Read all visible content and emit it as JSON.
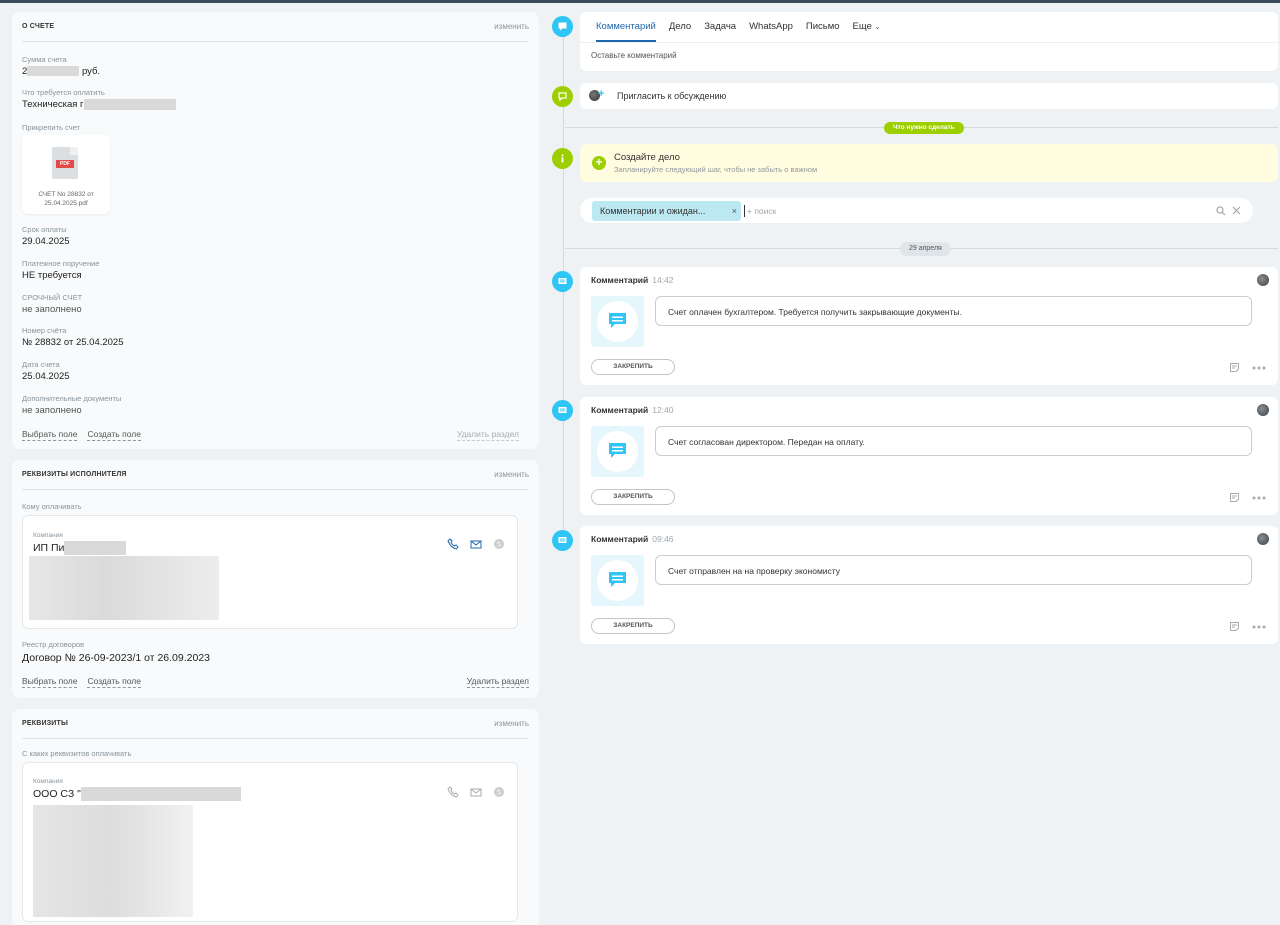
{
  "left": {
    "about": {
      "title": "О СЧЕТЕ",
      "edit": "изменить",
      "fields": [
        {
          "label": "Сумма счета",
          "value": "2",
          "suffix": "руб."
        },
        {
          "label": "Что требуется оплатить",
          "value": "Техническая г"
        },
        {
          "label": "Прикрепить счет"
        },
        {
          "label": "Срок оплаты",
          "value": "29.04.2025"
        },
        {
          "label": "Платежное поручение",
          "value": "НЕ требуется"
        },
        {
          "label": "СРОЧНЫЙ СЧЕТ",
          "value": "не заполнено"
        },
        {
          "label": "Номер счёта",
          "value": "№ 28832 от 25.04.2025"
        },
        {
          "label": "Дата счета",
          "value": "25.04.2025"
        },
        {
          "label": "Дополнительные документы",
          "value": "не заполнено"
        }
      ],
      "file_name": "СЧЕТ No 28832 от 25.04.2025.pdf",
      "file_badge": "PDF",
      "select_field": "Выбрать поле",
      "create_field": "Создать поле",
      "delete_section": "Удалить раздел"
    },
    "executor": {
      "title": "РЕКВИЗИТЫ ИСПОЛНИТЕЛЯ",
      "edit": "изменить",
      "pay_to_label": "Кому оплачивать",
      "company_label": "Компания",
      "company_name": "ИП Пи",
      "registry_label": "Реестр договоров",
      "registry_value": "Договор № 26-09-2023/1 от 26.09.2023",
      "select_field": "Выбрать поле",
      "create_field": "Создать поле",
      "delete_section": "Удалить раздел"
    },
    "requisites": {
      "title": "РЕКВИЗИТЫ",
      "edit": "изменить",
      "from_label": "С каких реквизитов оплачивать",
      "company_label": "Компания",
      "company_name": "ООО СЗ \""
    }
  },
  "right": {
    "tabs": [
      "Комментарий",
      "Дело",
      "Задача",
      "WhatsApp",
      "Письмо",
      "Еще"
    ],
    "comment_placeholder": "Оставьте комментарий",
    "invite": "Пригласить к обсуждению",
    "todo_pill": "Что нужно сделать",
    "todo_title": "Создайте дело",
    "todo_hint": "Запланируйте следующий шаг, чтобы не забыть о важном",
    "filter_chip": "Комментарии и ожидан...",
    "filter_placeholder": "+ поиск",
    "date_pill": "29 апреля",
    "comments": [
      {
        "type": "Комментарий",
        "time": "14:42",
        "text": "Счет оплачен бухгалтером. Требуется получить закрывающие документы.",
        "pin": "ЗАКРЕПИТЬ"
      },
      {
        "type": "Комментарий",
        "time": "12:40",
        "text": "Счет согласован директором. Передан на оплату.",
        "pin": "ЗАКРЕПИТЬ"
      },
      {
        "type": "Комментарий",
        "time": "09:46",
        "text": "Счет отправлен на на проверку экономисту",
        "pin": "ЗАКРЕПИТЬ"
      }
    ]
  },
  "colors": {
    "accent_blue": "#2fc6f6",
    "accent_green": "#9dcf00",
    "active_tab": "#2067b0",
    "todo_bg": "#fffce0"
  }
}
